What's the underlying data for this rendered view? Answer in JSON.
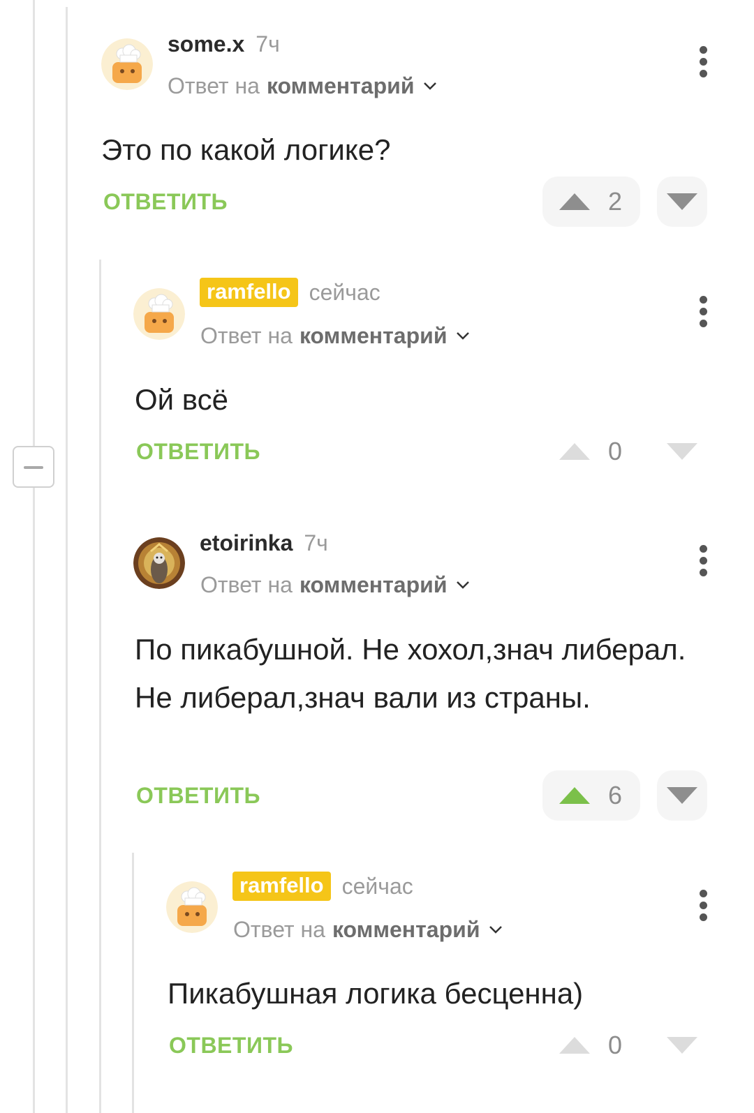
{
  "reply_label": "ОТВЕТИТЬ",
  "reply_to_prefix": "Ответ на",
  "reply_to_link": "комментарий",
  "comments": [
    {
      "author": "some.x",
      "time": "7ч",
      "text": "Это по какой логике?",
      "rating": "2",
      "avatar": "chef-icon"
    },
    {
      "author": "ramfello",
      "time": "сейчас",
      "text": "Ой всё",
      "rating": "0",
      "avatar": "chef-icon",
      "highlighted": true
    },
    {
      "author": "etoirinka",
      "time": "7ч",
      "text": "По пикабушной. Не хохол,знач либерал. Не либерал,знач вали из страны.",
      "rating": "6",
      "avatar": "user-photo",
      "upvoted": true
    },
    {
      "author": "ramfello",
      "time": "сейчас",
      "text": "Пикабушная логика бесценна)",
      "rating": "0",
      "avatar": "chef-icon",
      "highlighted": true
    }
  ],
  "colors": {
    "accent_green": "#8ac858",
    "badge_yellow": "#f5c518",
    "upvote_green": "#7bc04a"
  }
}
